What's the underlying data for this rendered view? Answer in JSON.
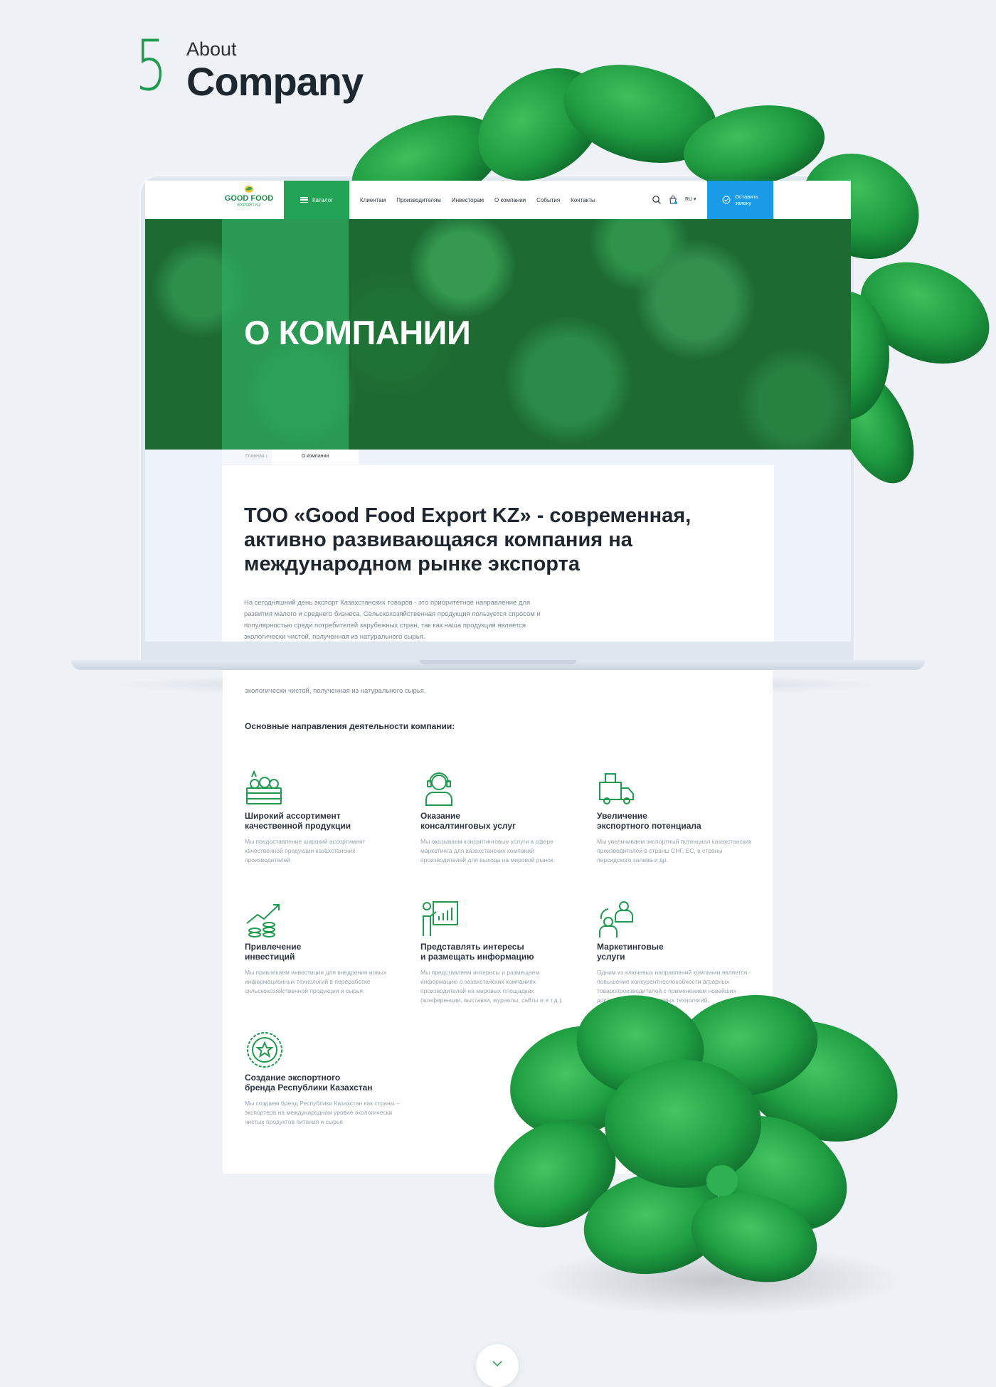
{
  "section": {
    "number": "5",
    "subtitle": "About",
    "title": "Company"
  },
  "site": {
    "logo": {
      "name": "GOOD FOOD",
      "tagline": "EXPORT.KZ"
    },
    "catalog_label": "Каталог",
    "nav": [
      "Клиентам",
      "Производителям",
      "Инвесторам",
      "О компании",
      "События",
      "Контакты"
    ],
    "lang": "RU ▾",
    "cta_label": "Оставить\nзаявку",
    "icons": {
      "search": "search-icon",
      "cart": "bag-icon",
      "cta": "check-circle-icon"
    }
  },
  "hero": {
    "title": "О КОМПАНИИ"
  },
  "breadcrumb": {
    "home": "Главная  ›",
    "current": "О компании"
  },
  "intro": {
    "title": "ТОО «Good Food Export KZ» - современная, активно развивающаяся компания на международном рынке экспорта",
    "text": "На сегодняшний день экспорт Казахстанских товаров - это приоритетное направление для развития малого и среднего бизнеса. Сельскохозяйственная продукция пользуется спросом и популярностью среди потребителей зарубежных стран, так как наша продукция является экологически чистой, полученная из натурального сырья.",
    "continuation": "экологически чистой, полученная из натурального сырья."
  },
  "directions": {
    "heading": "Основные направления деятельности компании:",
    "items": [
      {
        "icon": "vegetable-crate-icon",
        "title": "Широкий ассортимент\nкачественной продукции",
        "text": "Мы предоставление широкий ассортимент качественной продукции казахстанских производителей."
      },
      {
        "icon": "consultant-headset-icon",
        "title": "Оказание\nконсалтинговых услуг",
        "text": "Мы оказываем консалтинговые услуги в сфере маркетинга для казахстанских компаний производителей для выхода на мировой рынок."
      },
      {
        "icon": "delivery-truck-icon",
        "title": "Увеличение\nэкспортного потенциала",
        "text": "Мы увеличиваем экспортный потенциал казахстанских производителей в страны СНГ, ЕС, в страны персидского залива и др."
      },
      {
        "icon": "growth-coins-icon",
        "title": "Привлечение\nинвестиций",
        "text": "Мы привлекаем инвестиции для внедрения новых информационных технологий в переработке сельскохозяйственной продукции и сырья."
      },
      {
        "icon": "presentation-board-icon",
        "title": "Представлять интересы\nи размещать информацию",
        "text": "Мы представляем интересы и размещаем информацию о казахстанских компаниях производителей на мировых площадках (конференции, выставки, журналы, сайты и и т.д.)."
      },
      {
        "icon": "marketing-people-icon",
        "title": "Маркетинговые\nуслуги",
        "text": "Одним из ключевых направлений компании является - повышение конкурентноспособности аграрных товаропроизводителей с применением новейших достижений маркетинговых технологий."
      },
      {
        "icon": "star-badge-icon",
        "title": "Создание экспортного\nбренда Республики Казахстан",
        "text": "Мы создаем бренд Республики Казахстан как страны – экспортера на международном уровне экологически чистых продуктов питания и сырья."
      }
    ]
  },
  "colors": {
    "brand_green": "#22a356",
    "cta_blue": "#1a9be8",
    "background": "#eef2f7"
  }
}
